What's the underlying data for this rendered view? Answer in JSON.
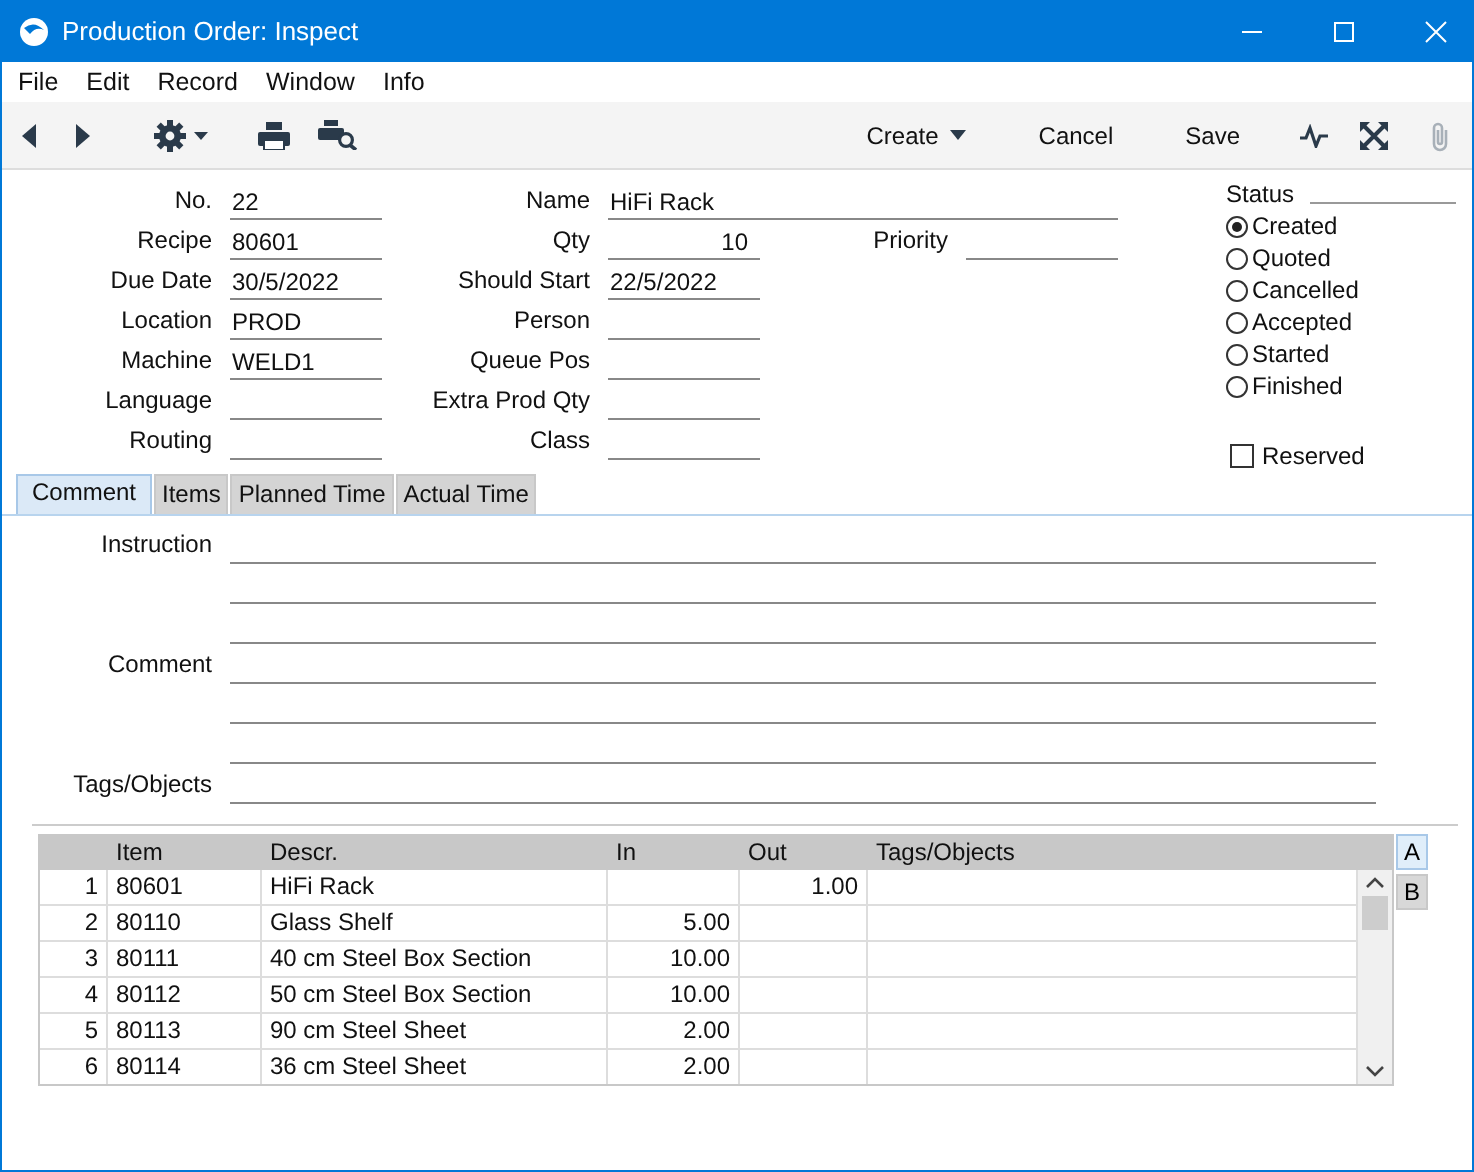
{
  "window": {
    "title": "Production Order: Inspect"
  },
  "menu": [
    "File",
    "Edit",
    "Record",
    "Window",
    "Info"
  ],
  "toolbar": {
    "buttons": [
      {
        "label": "Create",
        "kind": "dropdown"
      },
      {
        "label": "Cancel",
        "kind": "plain"
      },
      {
        "label": "Save",
        "kind": "plain"
      }
    ]
  },
  "fields_left": [
    {
      "label": "No.",
      "value": "22"
    },
    {
      "label": "Recipe",
      "value": "80601"
    },
    {
      "label": "Due Date",
      "value": "30/5/2022"
    },
    {
      "label": "Location",
      "value": "PROD"
    },
    {
      "label": "Machine",
      "value": "WELD1"
    },
    {
      "label": "Language"
    },
    {
      "label": "Routing"
    }
  ],
  "fields_middle": [
    {
      "label": "Name",
      "value": "HiFi Rack",
      "kind": "wide"
    },
    {
      "label": "Qty",
      "value": "10",
      "kind": "number"
    },
    {
      "label": "Should Start",
      "value": "22/5/2022"
    },
    {
      "label": "Person"
    },
    {
      "label": "Queue Pos"
    },
    {
      "label": "Extra Prod Qty"
    },
    {
      "label": "Class"
    }
  ],
  "priority": {
    "label": "Priority"
  },
  "status": {
    "label": "Status",
    "options": [
      {
        "label": "Created",
        "selected": true
      },
      {
        "label": "Quoted",
        "selected": false
      },
      {
        "label": "Cancelled",
        "selected": false
      },
      {
        "label": "Accepted",
        "selected": false
      },
      {
        "label": "Started",
        "selected": false
      },
      {
        "label": "Finished",
        "selected": false
      }
    ]
  },
  "reserved": {
    "label": "Reserved",
    "checked": false
  },
  "tabs": [
    {
      "label": "Comment",
      "selected": true
    },
    {
      "label": "Items",
      "selected": false
    },
    {
      "label": "Planned Time",
      "selected": false
    },
    {
      "label": "Actual Time",
      "selected": false
    }
  ],
  "comment_fields": [
    {
      "label": "Instruction"
    },
    {
      "label": "Comment"
    },
    {
      "label": "Tags/Objects"
    }
  ],
  "table": {
    "columns": [
      "Item",
      "Descr.",
      "In",
      "Out",
      "Tags/Objects"
    ],
    "rows": [
      {
        "no": "1",
        "item": "80601",
        "descr": "HiFi Rack",
        "out": "1.00"
      },
      {
        "no": "2",
        "item": "80110",
        "descr": "Glass Shelf",
        "in": "5.00"
      },
      {
        "no": "3",
        "item": "80111",
        "descr": "40 cm Steel Box Section",
        "in": "10.00"
      },
      {
        "no": "4",
        "item": "80112",
        "descr": "50 cm Steel Box Section",
        "in": "10.00"
      },
      {
        "no": "5",
        "item": "80113",
        "descr": "90 cm Steel Sheet",
        "in": "2.00"
      },
      {
        "no": "6",
        "item": "80114",
        "descr": "36 cm Steel Sheet",
        "in": "2.00"
      }
    ]
  },
  "view_buttons": [
    {
      "label": "A",
      "selected": true
    },
    {
      "label": "B",
      "selected": false
    }
  ]
}
